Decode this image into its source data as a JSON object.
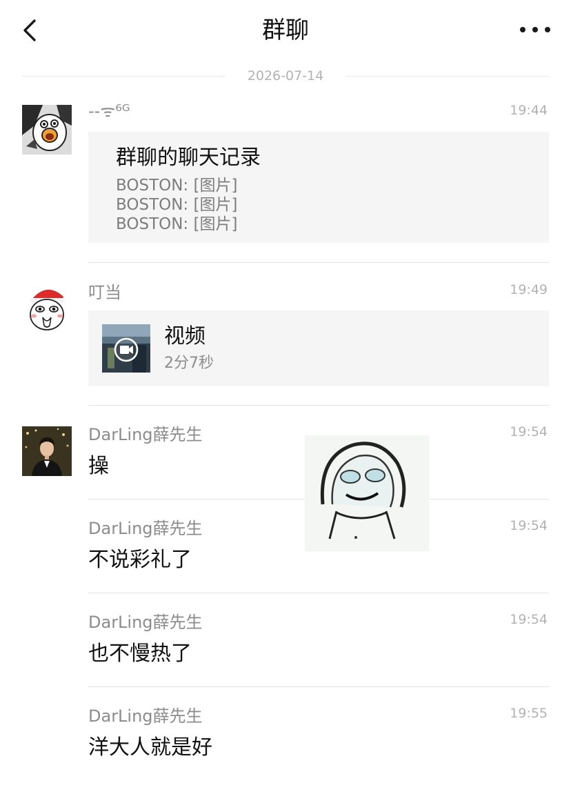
{
  "header": {
    "title": "群聊",
    "back_icon": "chevron-left-icon",
    "more_icon": "more-dots-icon"
  },
  "date_divider": "2026-07-14",
  "messages": [
    {
      "sender": "--ᯤ⁶ᴳ",
      "time": "19:44",
      "avatar_icon": "cartoon-goose-avatar",
      "chat_record": {
        "title": "群聊的聊天记录",
        "lines": [
          "BOSTON: [图片]",
          "BOSTON: [图片]",
          "BOSTON: [图片]"
        ]
      }
    },
    {
      "sender": "叮当",
      "time": "19:49",
      "avatar_icon": "santa-hat-cartoon-avatar",
      "video": {
        "title": "视频",
        "duration": "2分7秒",
        "play_icon": "video-camera-icon"
      }
    },
    {
      "sender": "DarLing薛先生",
      "time": "19:54",
      "avatar_icon": "person-photo-avatar",
      "text": "操"
    },
    {
      "sender": "DarLing薛先生",
      "time": "19:54",
      "text": "不说彩礼了"
    },
    {
      "sender": "DarLing薛先生",
      "time": "19:54",
      "text": "也不慢热了"
    },
    {
      "sender": "DarLing薛先生",
      "time": "19:55",
      "text": "洋大人就是好"
    }
  ],
  "sticker_icon": "meme-face-sticker"
}
